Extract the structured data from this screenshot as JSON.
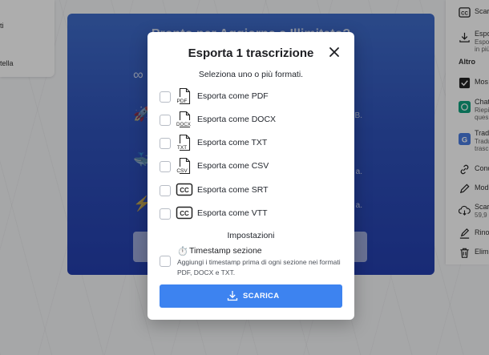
{
  "background": {
    "left_panel_items": [
      "ti",
      "tella"
    ],
    "promo": {
      "title": "Pronto per Aggiorna a Illimitato?",
      "suffixes": [
        "B.",
        "a.",
        "a."
      ]
    },
    "right_panel": {
      "items": [
        {
          "label": "Scar",
          "sub": "",
          "icon": "cc-icon"
        },
        {
          "label": "Espo",
          "sub": "Espo\nin più",
          "icon": "download-icon"
        },
        {
          "label": "Mos",
          "sub": "",
          "icon": "checkbox-icon"
        },
        {
          "label": "Chat",
          "sub": "Riepi\nques",
          "icon": "chatgpt-icon"
        },
        {
          "label": "Trad",
          "sub": "Tradu\ntrasc",
          "icon": "translate-icon"
        },
        {
          "label": "Cond",
          "sub": "",
          "icon": "link-icon"
        },
        {
          "label": "Mod",
          "sub": "",
          "icon": "pencil-icon"
        },
        {
          "label": "Scar",
          "sub": "59,9",
          "icon": "cloud-download-icon"
        },
        {
          "label": "Rino",
          "sub": "",
          "icon": "rename-icon"
        },
        {
          "label": "Elim",
          "sub": "",
          "icon": "trash-icon"
        }
      ],
      "section_label": "Altro"
    }
  },
  "modal": {
    "title": "Esporta 1 trascrizione",
    "subtitle": "Seleziona uno o più formati.",
    "formats": [
      {
        "label": "Esporta come PDF",
        "badge": "PDF",
        "icon": "file-pdf-icon"
      },
      {
        "label": "Esporta come DOCX",
        "badge": "DOCX",
        "icon": "file-docx-icon"
      },
      {
        "label": "Esporta come TXT",
        "badge": "TXT",
        "icon": "file-txt-icon"
      },
      {
        "label": "Esporta come CSV",
        "badge": "CSV",
        "icon": "file-csv-icon"
      },
      {
        "label": "Esporta come SRT",
        "badge": "CC",
        "icon": "cc-icon"
      },
      {
        "label": "Esporta come VTT",
        "badge": "CC",
        "icon": "cc-icon"
      }
    ],
    "settings_title": "Impostazioni",
    "timestamp": {
      "icon": "⏱️",
      "title": "Timestamp sezione",
      "description": "Aggiungi i timestamp prima di ogni sezione nei formati PDF, DOCX e TXT."
    },
    "download_label": "SCARICA",
    "colors": {
      "primary": "#3d83f0",
      "promo": "#2f52b9"
    }
  }
}
